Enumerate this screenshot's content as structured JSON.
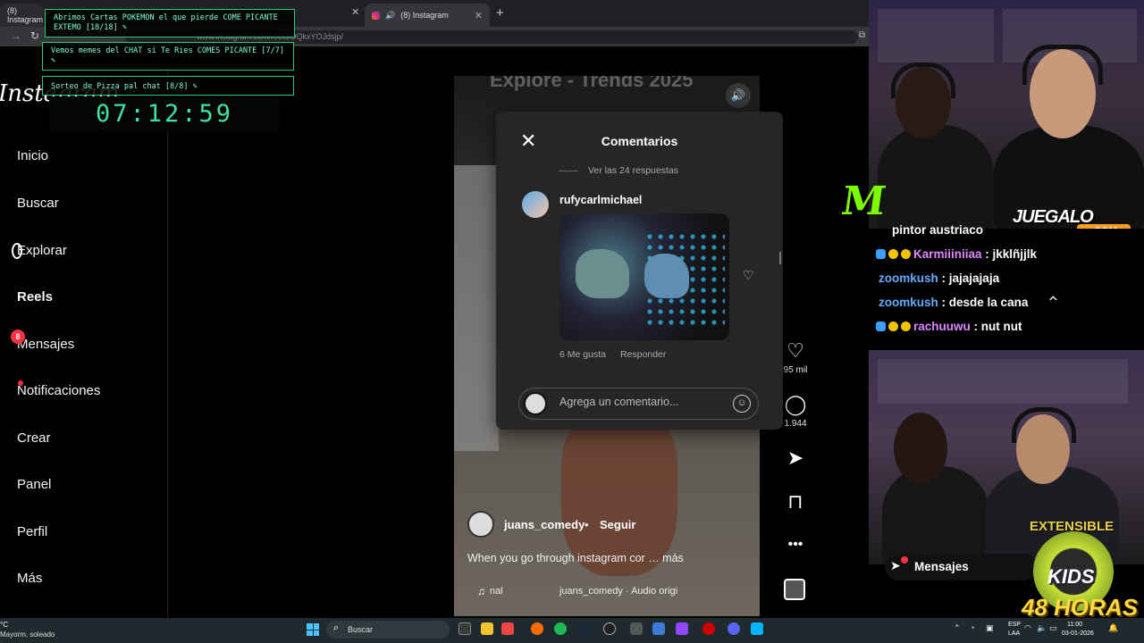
{
  "browser": {
    "tabs": [
      {
        "label": "(8) Instagram"
      },
      {
        "label": "(8) Instagram"
      }
    ],
    "new_tab_icon": "plus-icon",
    "url": "www.instagram.com/reels/DQkxYOJdsjp/"
  },
  "overlay": {
    "items": [
      {
        "text": "Abrimos Cartas POKEMON el que pierde COME PICANTE EXTEMO [18/18] ✎"
      },
      {
        "text": "Vemos memes del CHAT si Te Ries COMES PICANTE [7/7] ✎"
      },
      {
        "text": "Sorteo de Pizza pal chat [8/8] ✎"
      }
    ],
    "timer": "07:12:59"
  },
  "instagram": {
    "logo": "Instagram",
    "nav": [
      {
        "label": "Inicio"
      },
      {
        "label": "Buscar"
      },
      {
        "label": "Explorar"
      },
      {
        "label": "Reels"
      },
      {
        "label": "Mensajes",
        "badge": "8"
      },
      {
        "label": "Notificaciones"
      },
      {
        "label": "Crear"
      },
      {
        "label": "Panel"
      },
      {
        "label": "Perfil"
      },
      {
        "label": "Más"
      }
    ],
    "reel": {
      "title": "Explore - Trends 2025",
      "author": "juans_comedy",
      "follow": "Seguir",
      "caption": "When you go through instagram cor … más",
      "music": "nal",
      "audio": "juans_comedy · Audio origi",
      "likes": "95 mil",
      "comments": "1.944"
    },
    "comments_panel": {
      "title": "Comentarios",
      "replies": "Ver las 24 respuestas",
      "comment_user": "rufycarlmichael",
      "comment_likes": "6 Me gusta",
      "reply": "Responder",
      "input_placeholder": "Agrega un comentario..."
    }
  },
  "stream": {
    "sponsor": "JUEGALO",
    "sponsor_domain": ".COM",
    "chat": [
      {
        "user": "",
        "message": "pintor austriaco"
      },
      {
        "user": "Karmiiiniiaa",
        "message": ": jkklñjjlk"
      },
      {
        "user": "zoomkush",
        "message": ": jajajajaja"
      },
      {
        "user": "zoomkush",
        "message": ": desde la cana"
      },
      {
        "user": "rachuuwu",
        "message": ": nut nut"
      }
    ],
    "mensajes_label": "Mensajes",
    "event_top": "EXTENSIBLE",
    "event_logo": "KIDS",
    "event_bottom": "48 HORAS"
  },
  "taskbar": {
    "weather_temp": "°C",
    "weather_desc": "Mayorm. soleado",
    "search_label": "Buscar",
    "lang1": "ESP",
    "lang2": "LAA",
    "time": "11:00",
    "date": "03-01-2026"
  },
  "colors": {
    "overlay_border": "#2ecc71",
    "timer": "#3fe0a0",
    "badge": "#ff3040",
    "monster": "#7cfc00",
    "juegalo_com": "#ff9f1a"
  }
}
